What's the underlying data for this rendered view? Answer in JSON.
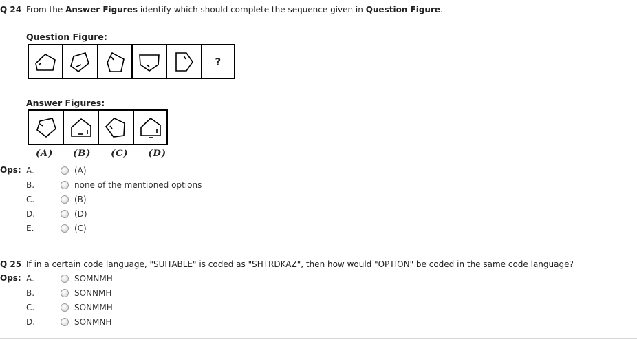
{
  "q24": {
    "number": "Q 24",
    "text_pre": "From the ",
    "text_b1": "Answer Figures",
    "text_mid": " identify which should complete the sequence given in ",
    "text_b2": "Question Figure",
    "text_post": ".",
    "question_figure_label": "Question Figure:",
    "question_mark": "?",
    "answer_figures_label": "Answer Figures:",
    "answer_letters": [
      "(A)",
      "(B)",
      "(C)",
      "(D)"
    ],
    "ops_label": "Ops:",
    "options": [
      {
        "letter": "A.",
        "text": "(A)"
      },
      {
        "letter": "B.",
        "text": "none of the mentioned options"
      },
      {
        "letter": "C.",
        "text": "(B)"
      },
      {
        "letter": "D.",
        "text": "(D)"
      },
      {
        "letter": "E.",
        "text": "(C)"
      }
    ]
  },
  "q25": {
    "number": "Q 25",
    "text": "If in a certain code language, \"SUITABLE\" is coded as \"SHTRDKAZ\", then how would \"OPTION\" be coded in the same code language?",
    "ops_label": "Ops:",
    "options": [
      {
        "letter": "A.",
        "text": "SOMNMH"
      },
      {
        "letter": "B.",
        "text": "SONNMH"
      },
      {
        "letter": "C.",
        "text": "SONMMH"
      },
      {
        "letter": "D.",
        "text": "SONMNH"
      }
    ]
  },
  "icons": {
    "radio": "radio-button-icon",
    "question_shapes": [
      "pentagon-corner-line-icon",
      "pentagon-corner-line-icon",
      "pentagon-corner-line-icon",
      "pentagon-corner-line-icon",
      "pentagon-corner-line-icon"
    ],
    "answer_shapes": [
      "pentagon-corner-line-icon",
      "pentagon-side-line-icon",
      "pentagon-corner-line-icon",
      "pentagon-bottom-line-icon"
    ]
  }
}
